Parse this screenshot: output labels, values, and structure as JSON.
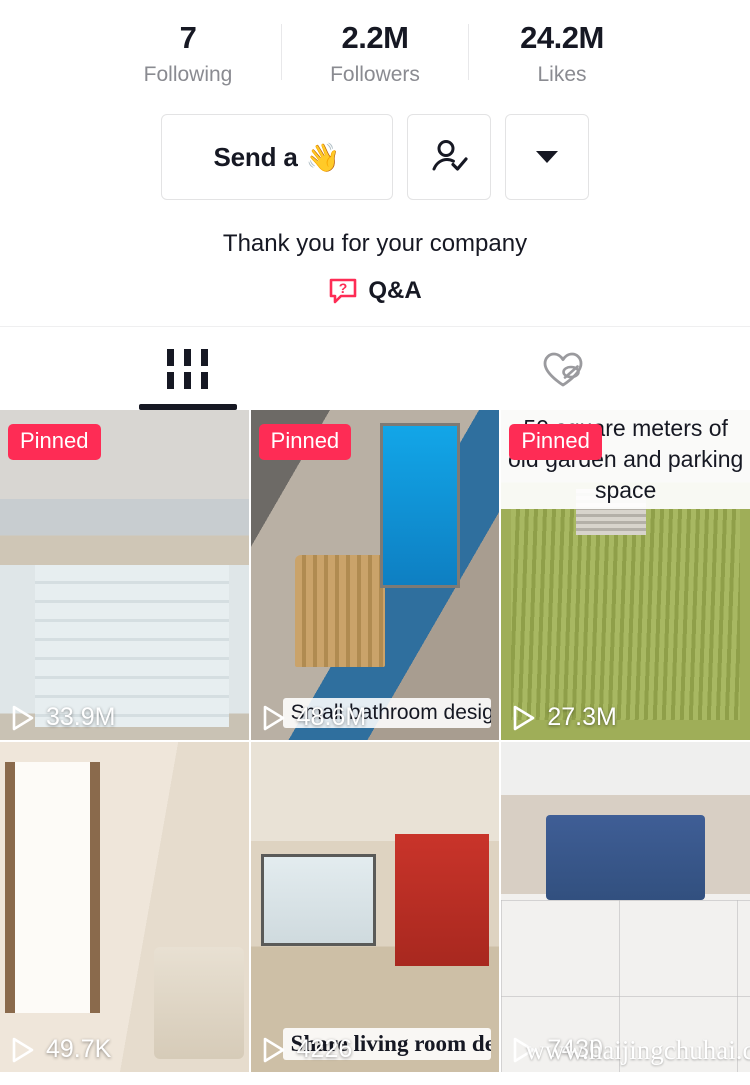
{
  "stats": [
    {
      "value": "7",
      "label": "Following"
    },
    {
      "value": "2.2M",
      "label": "Followers"
    },
    {
      "value": "24.2M",
      "label": "Likes"
    }
  ],
  "actions": {
    "primary_label": "Send a",
    "primary_emoji": "👋",
    "follow_icon": "person-check-icon",
    "more_icon": "chevron-down-icon"
  },
  "bio": {
    "text": "Thank you for your company",
    "qa_label": "Q&A",
    "qa_icon": "question-bubble-icon",
    "qa_color": "#fe2c55"
  },
  "tabs": [
    {
      "name": "videos",
      "icon": "grid-icon",
      "active": true
    },
    {
      "name": "liked",
      "icon": "heart-slash-icon",
      "active": false
    }
  ],
  "videos": [
    {
      "badge": "Pinned",
      "views": "33.9M",
      "caption_bottom": "",
      "caption_top": "",
      "watermark": "",
      "art": "art-loft"
    },
    {
      "badge": "Pinned",
      "views": "48.6M",
      "caption_bottom": "Small bathroom design",
      "caption_top": "",
      "watermark": "",
      "art": "art-bath"
    },
    {
      "badge": "Pinned",
      "views": "27.3M",
      "caption_bottom": "",
      "caption_top": "50 square meters of old garden and parking space",
      "watermark": "",
      "art": "art-garden"
    },
    {
      "badge": "",
      "views": "49.7K",
      "caption_bottom": "",
      "caption_top": "",
      "watermark": "",
      "art": "art-bedroom"
    },
    {
      "badge": "",
      "views": "4226",
      "caption_bottom": "Share living room design",
      "caption_top": "",
      "watermark": "",
      "art": "art-living"
    },
    {
      "badge": "",
      "views": "7430",
      "caption_bottom": "",
      "caption_top": "",
      "watermark": "www.haijingchuhai.com",
      "art": "art-sofa"
    }
  ],
  "colors": {
    "accent": "#fe2c55",
    "text": "#161823",
    "muted": "#8a8b91"
  }
}
